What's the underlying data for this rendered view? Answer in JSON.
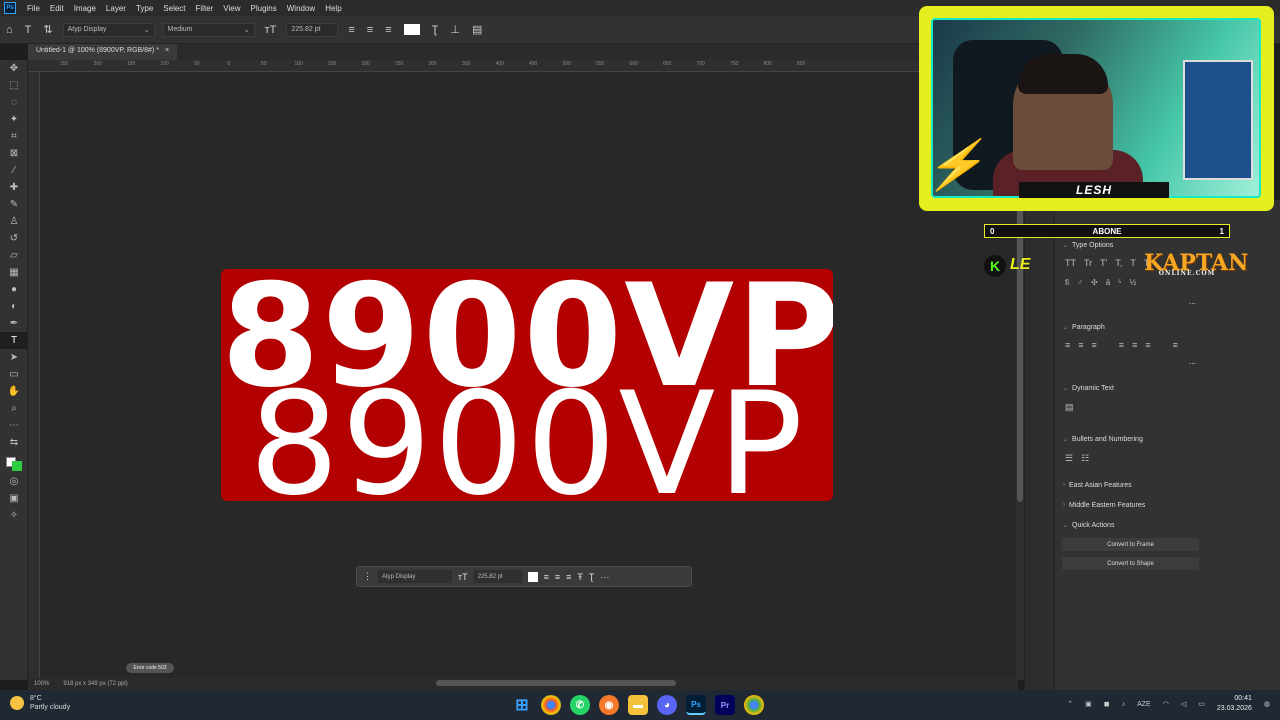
{
  "menubar": {
    "items": [
      "File",
      "Edit",
      "Image",
      "Layer",
      "Type",
      "Select",
      "Filter",
      "View",
      "Plugins",
      "Window",
      "Help"
    ]
  },
  "options": {
    "font_family": "Atyp Display",
    "font_style": "Medium",
    "font_size": "225.82 pt"
  },
  "document": {
    "tab_title": "Untitled-1 @ 100% (8900VP, RGB/8#) *",
    "close": "×"
  },
  "ruler_marks": [
    "250",
    "200",
    "150",
    "100",
    "50",
    "0",
    "50",
    "100",
    "150",
    "200",
    "250",
    "300",
    "350",
    "400",
    "450",
    "500",
    "550",
    "600",
    "650",
    "700",
    "750",
    "800",
    "850"
  ],
  "artboard": {
    "line1": "8900VP",
    "line2": "8900VP",
    "color": "#b30000"
  },
  "context_bar": {
    "font_family": "Atyp Display",
    "font_size": "225.82 pt",
    "more": "···"
  },
  "status": {
    "zoom": "100%",
    "dimensions": "918 px x 349 px (72 ppi)",
    "error_badge": "Error code 503"
  },
  "panel": {
    "type_options": "Type Options",
    "paragraph": "Paragraph",
    "dynamic_text": "Dynamic Text",
    "bullets": "Bullets and Numbering",
    "east_asian": "East Asian Features",
    "middle_eastern": "Middle Eastern Features",
    "quick_actions": "Quick Actions",
    "convert_frame": "Convert to Frame",
    "convert_shape": "Convert to Shape",
    "type_glyphs": [
      "TT",
      "Tr",
      "T'",
      "T,",
      "T",
      "T"
    ]
  },
  "stream": {
    "name": "LESH",
    "sub_left": "0",
    "sub_label": "ABONE",
    "sub_right": "1",
    "sponsor_main": "KAPTAN",
    "sponsor_sub": "ONLINE.COM",
    "k_badge": "K",
    "le_badge": "LE"
  },
  "taskbar": {
    "weather_temp": "8°C",
    "weather_desc": "Partly cloudy",
    "lang": "AZE",
    "time": "00:41",
    "date": "23.03.2026"
  }
}
